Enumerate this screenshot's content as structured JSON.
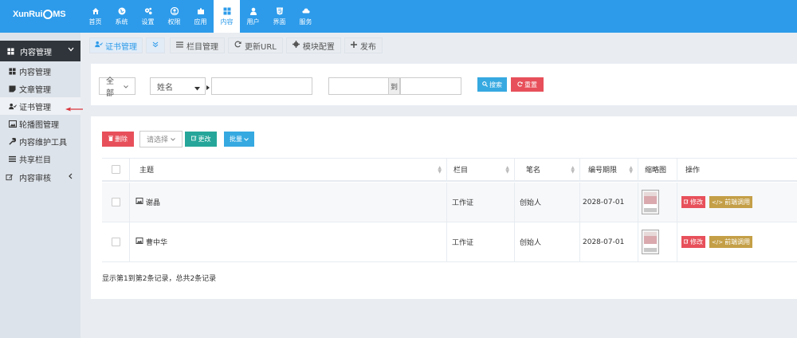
{
  "app": {
    "logo_pre": "XunRui",
    "logo_post": "MS"
  },
  "nav": [
    {
      "label": "首页",
      "icon": "home-icon"
    },
    {
      "label": "系统",
      "icon": "globe-icon"
    },
    {
      "label": "设置",
      "icon": "cogs-icon"
    },
    {
      "label": "权限",
      "icon": "user-circle-icon"
    },
    {
      "label": "应用",
      "icon": "puzzle-icon"
    },
    {
      "label": "内容",
      "icon": "grid-icon",
      "active": true
    },
    {
      "label": "用户",
      "icon": "user-icon"
    },
    {
      "label": "界面",
      "icon": "html5-icon"
    },
    {
      "label": "服务",
      "icon": "cloud-icon"
    }
  ],
  "sidebar": {
    "header": "内容管理",
    "items": [
      {
        "label": "内容管理",
        "icon": "grid-icon"
      },
      {
        "label": "文章管理",
        "icon": "sticky-note-icon"
      },
      {
        "label": "证书管理",
        "icon": "user-check-icon",
        "active": true
      },
      {
        "label": "轮播图管理",
        "icon": "image-icon"
      },
      {
        "label": "内容维护工具",
        "icon": "wrench-icon"
      },
      {
        "label": "共享栏目",
        "icon": "list-icon"
      }
    ],
    "section2": "内容审核"
  },
  "toolbar": {
    "cert": "证书管理",
    "column": "栏目管理",
    "update_url": "更新URL",
    "module_config": "模块配置",
    "publish": "发布"
  },
  "search": {
    "scope": "全部",
    "field": "姓名",
    "range_sep": "到",
    "search_btn": "搜索",
    "reset_btn": "重置"
  },
  "actions": {
    "delete": "删除",
    "select_placeholder": "请选择",
    "change": "更改",
    "batch": "批量"
  },
  "table": {
    "headers": [
      "主题",
      "栏目",
      "笔名",
      "编号期限",
      "缩略图",
      "操作"
    ],
    "rows": [
      {
        "title": "谢晶",
        "column": "工作证",
        "author": "创始人",
        "date": "2028-07-01"
      },
      {
        "title": "曹中华",
        "column": "工作证",
        "author": "创始人",
        "date": "2028-07-01"
      }
    ],
    "edit_btn": "修改",
    "call_btn": "前端调用",
    "footer": "显示第1到第2条记录，总共2条记录"
  },
  "colors": {
    "topbar": "#2d9bea",
    "sidebar_head": "#2f353b",
    "blue_btn": "#36a9e1",
    "red_btn": "#e7505a",
    "green_btn": "#26a69a",
    "gold_btn": "#c49f47"
  }
}
